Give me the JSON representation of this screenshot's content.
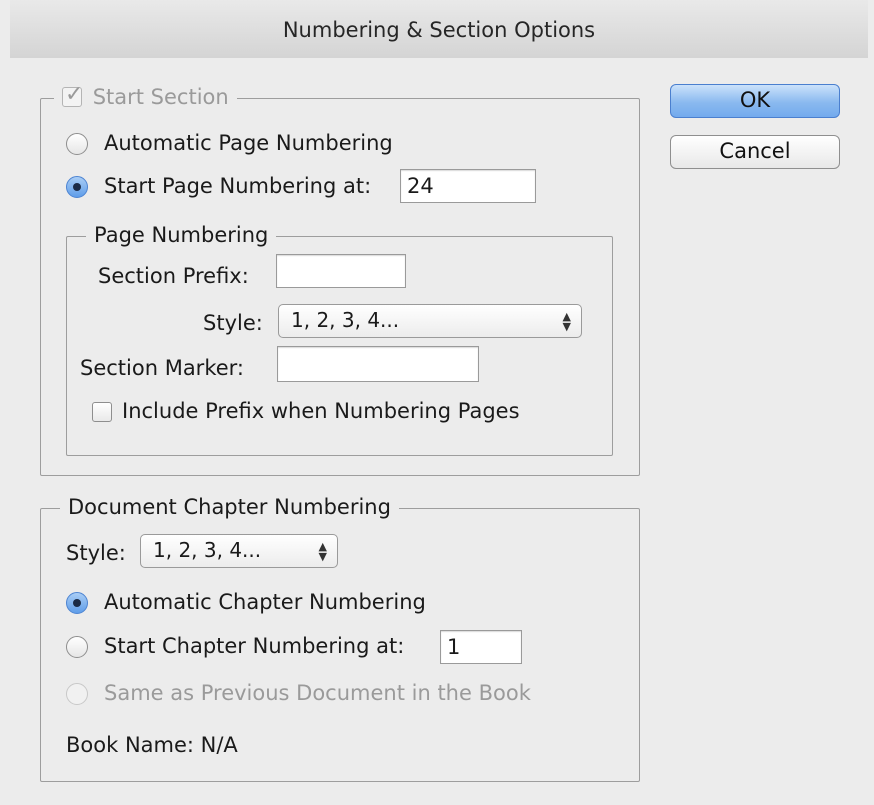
{
  "dialog": {
    "title": "Numbering & Section Options"
  },
  "buttons": {
    "ok": "OK",
    "cancel": "Cancel"
  },
  "start_section": {
    "label": "Start Section",
    "checked": true,
    "automatic_page_numbering": "Automatic Page Numbering",
    "start_page_numbering_at": "Start Page Numbering at:",
    "start_page_value": "24"
  },
  "page_numbering": {
    "legend": "Page Numbering",
    "section_prefix_label": "Section Prefix:",
    "section_prefix_value": "",
    "style_label": "Style:",
    "style_value": "1, 2, 3, 4...",
    "section_marker_label": "Section Marker:",
    "section_marker_value": "",
    "include_prefix_label": "Include Prefix when Numbering Pages"
  },
  "chapter_numbering": {
    "legend": "Document Chapter Numbering",
    "style_label": "Style:",
    "style_value": "1, 2, 3, 4...",
    "automatic_label": "Automatic Chapter Numbering",
    "start_at_label": "Start Chapter Numbering at:",
    "start_at_value": "1",
    "same_as_previous_label": "Same as Previous Document in the Book",
    "book_name_label": "Book Name: N/A"
  }
}
